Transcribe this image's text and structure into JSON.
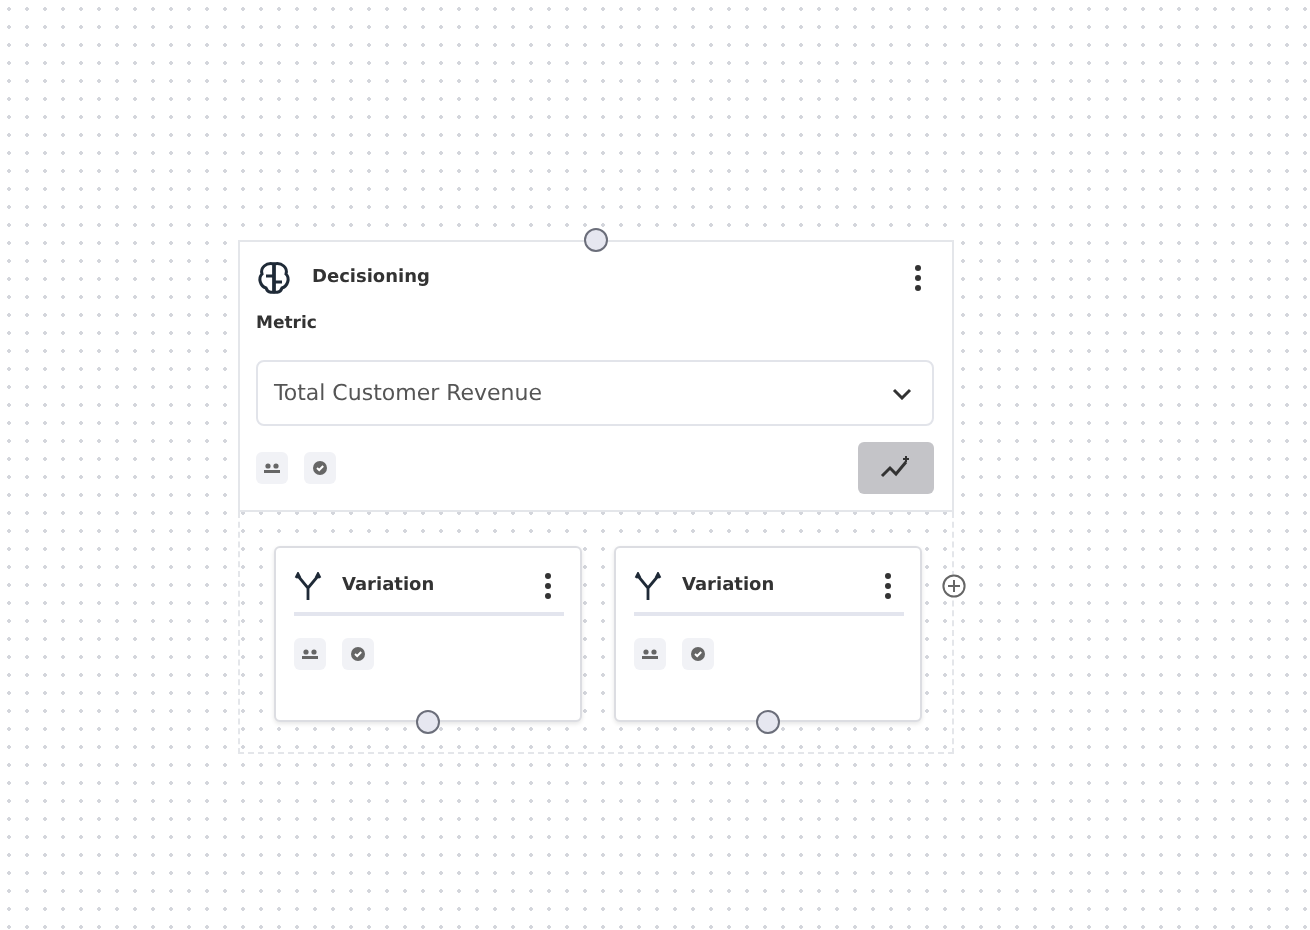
{
  "node": {
    "title": "Decisioning",
    "metric_label": "Metric",
    "metric_value": "Total Customer Revenue"
  },
  "variations": [
    {
      "title": "Variation"
    },
    {
      "title": "Variation"
    }
  ]
}
